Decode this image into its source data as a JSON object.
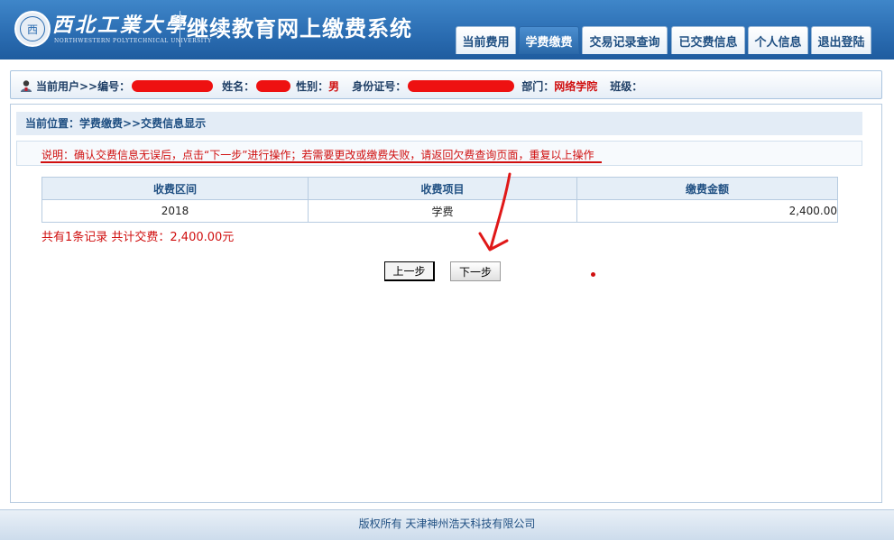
{
  "header": {
    "university_name": "西北工業大學",
    "university_name_en": "NORTHWESTERN POLYTECHNICAL UNIVERSITY",
    "system_title": "继续教育网上缴费系统",
    "logo_glyph": "西"
  },
  "nav": {
    "items": [
      {
        "label": "当前费用",
        "active": false
      },
      {
        "label": "学费缴费",
        "active": true
      },
      {
        "label": "交易记录查询",
        "active": false
      },
      {
        "label": "已交费信息",
        "active": false
      },
      {
        "label": "个人信息",
        "active": false
      },
      {
        "label": "退出登陆",
        "active": false
      }
    ]
  },
  "user_info": {
    "current_user_label": "当前用户>>",
    "id_label": "编号：",
    "name_label": "姓名：",
    "gender_label": "性别：",
    "gender_value": "男",
    "idcard_label": "身份证号：",
    "dept_label": "部门：",
    "dept_value": "网络学院",
    "class_label": "班级："
  },
  "breadcrumb": "当前位置：学费缴费>>交费信息显示",
  "notice": "说明：确认交费信息无误后，点击“下一步”进行操作；若需要更改或缴费失败，请返回欠费查询页面，重复以上操作",
  "table": {
    "headers": [
      "收费区间",
      "收费项目",
      "缴费金额"
    ],
    "rows": [
      [
        "2018",
        "学费",
        "2,400.00"
      ]
    ]
  },
  "summary": "共有1条记录  共计交费：2,400.00元",
  "buttons": {
    "prev": "上一步",
    "next": "下一步"
  },
  "footer": "版权所有 天津神州浩天科技有限公司",
  "colors": {
    "header_blue": "#2a6cb1",
    "accent_red": "#d01010",
    "text_blue": "#1f4f82"
  }
}
